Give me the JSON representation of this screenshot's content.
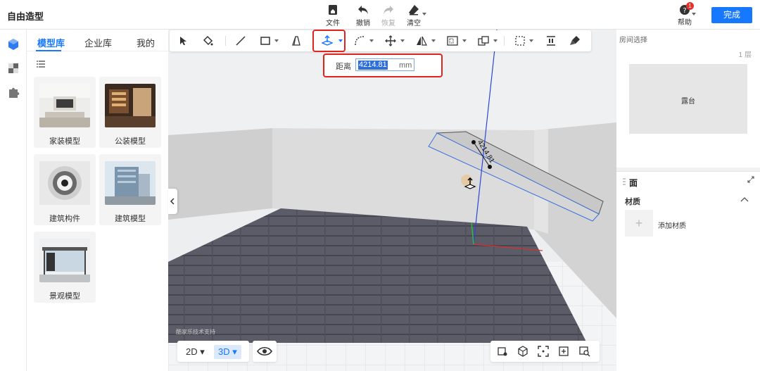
{
  "app": {
    "title": "自由造型"
  },
  "topbar": {
    "file_label": "文件",
    "undo_label": "撤销",
    "redo_label": "恢复",
    "clear_label": "清空",
    "help_label": "帮助",
    "help_badge": "1",
    "done_label": "完成"
  },
  "library": {
    "tabs": [
      "模型库",
      "企业库",
      "我的"
    ],
    "active_tab": "模型库",
    "cards": [
      {
        "label": "家装模型",
        "icon": "living-room-thumb"
      },
      {
        "label": "公装模型",
        "icon": "restaurant-thumb"
      },
      {
        "label": "建筑构件",
        "icon": "spiral-stair-thumb"
      },
      {
        "label": "建筑模型",
        "icon": "building-thumb"
      },
      {
        "label": "景观模型",
        "icon": "bus-shelter-thumb"
      }
    ]
  },
  "toolbar": {
    "tools": [
      "select-icon",
      "paint-bucket-icon",
      "line-icon",
      "rectangle-icon",
      "extrude-icon",
      "push-pull-icon",
      "arc-icon",
      "move-icon",
      "mirror-icon",
      "offset-icon",
      "group-icon",
      "align-icon",
      "distribute-icon",
      "brush-icon"
    ],
    "active_tool": "push-pull-icon"
  },
  "distance": {
    "label": "距离",
    "value": "4214.81",
    "unit": "mm"
  },
  "viewport": {
    "dimension_label": "4214.81",
    "watermark": "酷家乐技术支持",
    "mode_2d": "2D",
    "mode_3d": "3D",
    "active_mode": "3D"
  },
  "room_panel": {
    "title": "房间选择",
    "floor": "1 层",
    "room_name": "露台"
  },
  "face_panel": {
    "title": "面",
    "material_section": "材质",
    "add_material_label": "添加材质"
  },
  "colors": {
    "accent": "#1677ff",
    "highlight": "#e0251f",
    "floor": "#5a5b66"
  }
}
